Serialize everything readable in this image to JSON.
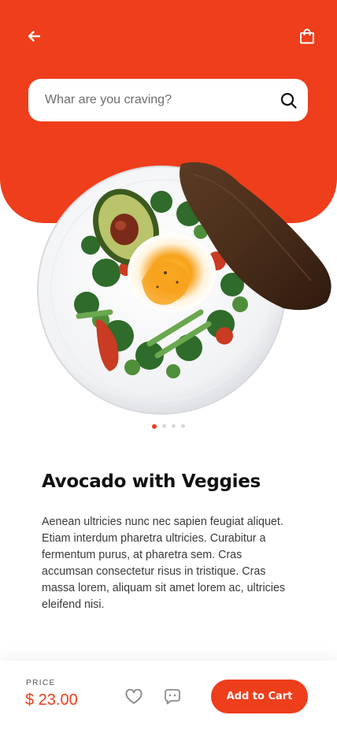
{
  "search": {
    "placeholder": "Whar are you craving?"
  },
  "carousel": {
    "total": 4,
    "active_index": 0
  },
  "dish": {
    "title": "Avocado with Veggies",
    "description": "Aenean ultricies nunc nec sapien feugiat aliquet. Etiam interdum pharetra ultricies. Curabitur a fermentum purus, at pharetra sem. Cras accumsan consectetur risus in tristique. Cras massa lorem, aliquam sit amet lorem ac, ultricies eleifend nisi."
  },
  "purchase": {
    "price_label": "PRICE",
    "price": "$ 23.00",
    "add_to_cart_label": "Add to Cart"
  },
  "icons": {
    "back": "arrow-left-icon",
    "bag": "shopping-bag-icon",
    "search": "search-icon",
    "favorite": "heart-icon",
    "chat": "chat-icon"
  },
  "colors": {
    "accent": "#ee3e1b",
    "background": "#ffffff",
    "text": "#111111",
    "muted": "#3a3a3a"
  }
}
